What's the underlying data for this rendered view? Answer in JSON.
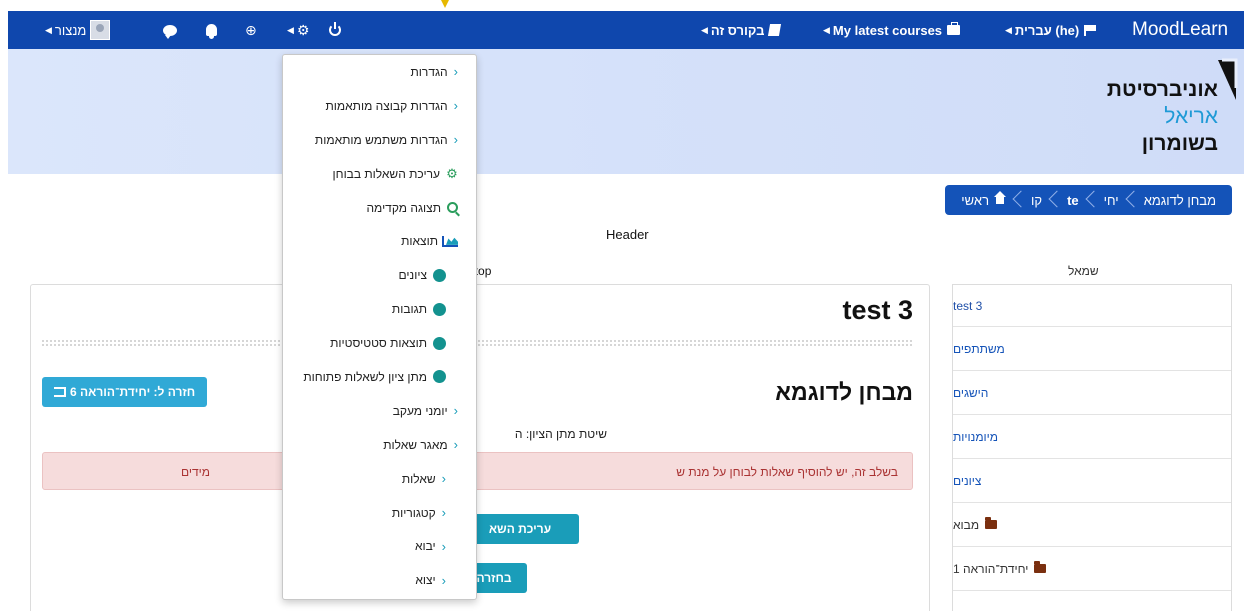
{
  "topbar": {
    "brand": "MoodLearn",
    "language": "עברית (he)",
    "my_courses": "My latest courses",
    "this_course": "בקורס זה",
    "user": "מנצור",
    "colors": {
      "bar": "#0f47ad",
      "teal": "#1a9db9"
    }
  },
  "logo": {
    "line1": "אוניברסיטת",
    "line2": "אריאל",
    "line3": "בשומרון"
  },
  "breadcrumb": {
    "home": "ראשי",
    "items": [
      "קו",
      "te",
      "יחי",
      "מבחן לדוגמא"
    ]
  },
  "labels": {
    "header": "Header",
    "page_top": "ge top",
    "left_region": "שמאל"
  },
  "left_nav": {
    "items": [
      "test 3",
      "משתתפים",
      "הישגים",
      "מיומנויות",
      "ציונים"
    ],
    "folders": [
      "מבוא",
      "יחידת־הוראה 1"
    ]
  },
  "main": {
    "course_title": "test 3",
    "quiz_title": "מבחן לדוגמא",
    "back_button": "חזרה ל: יחידת־הוראה 6",
    "grading_method": "שיטת מתן הציון: ה",
    "alert_text": "בשלב זה, יש להוסיף שאלות לבוחן על מנת ש",
    "alert_tail": "מידים",
    "edit_questions_button": "עריכת השא",
    "preview_button": "בחזרה"
  },
  "dropdown": {
    "items": [
      {
        "label": "הגדרות",
        "icon": "chevron-left-icon",
        "sub": false
      },
      {
        "label": "הגדרות קבוצה מותאמות",
        "icon": "chevron-left-icon",
        "sub": false
      },
      {
        "label": "הגדרות משתמש מותאמות",
        "icon": "chevron-left-icon",
        "sub": false
      },
      {
        "label": "עריכת השאלות בבוחן",
        "icon": "gear-icon",
        "sub": false
      },
      {
        "label": "תצוגה מקדימה",
        "icon": "search-plus-icon",
        "sub": false
      },
      {
        "label": "תוצאות",
        "icon": "area-chart-icon",
        "sub": false
      },
      {
        "label": "ציונים",
        "icon": "circle-icon",
        "sub": true
      },
      {
        "label": "תגובות",
        "icon": "circle-icon",
        "sub": true
      },
      {
        "label": "תוצאות סטטיסטיות",
        "icon": "circle-icon",
        "sub": true
      },
      {
        "label": "מתן ציון לשאלות פתוחות",
        "icon": "circle-icon",
        "sub": true
      },
      {
        "label": "יומני מעקב",
        "icon": "chevron-left-icon",
        "sub": false
      },
      {
        "label": "מאגר שאלות",
        "icon": "chevron-left-icon",
        "sub": false
      },
      {
        "label": "שאלות",
        "icon": "chevron-left-icon",
        "sub": true
      },
      {
        "label": "קטגוריות",
        "icon": "chevron-left-icon",
        "sub": true
      },
      {
        "label": "יבוא",
        "icon": "chevron-left-icon",
        "sub": true
      },
      {
        "label": "יצוא",
        "icon": "chevron-left-icon",
        "sub": true
      }
    ]
  }
}
